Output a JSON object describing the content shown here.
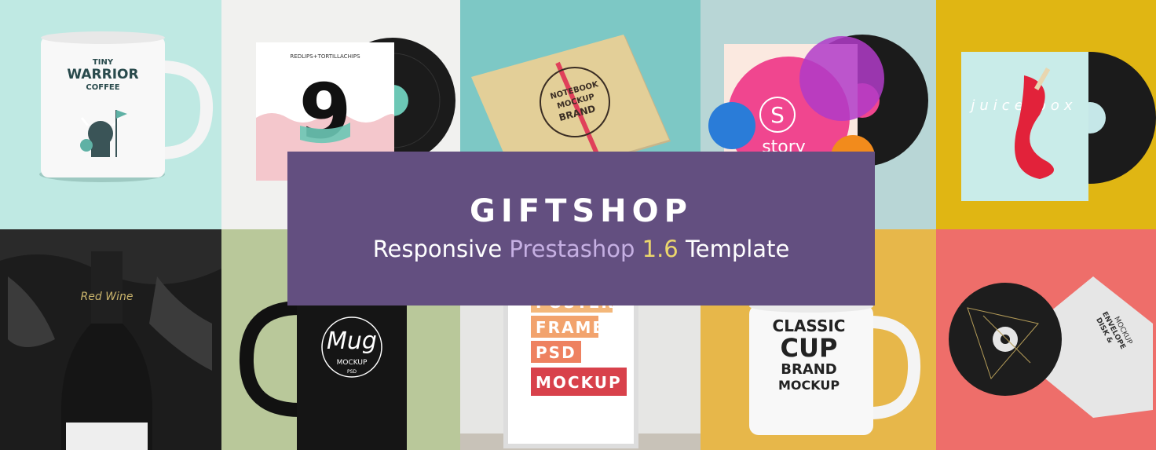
{
  "banner": {
    "title": "GIFTSHOP",
    "subtitle": {
      "part1": "Responsive ",
      "part2": "Prestashop",
      "part3": " ",
      "part4": "1.6",
      "part5": " Template"
    },
    "overlay_color": "#634f80",
    "highlight_color_1": "#c6b0e3",
    "highlight_color_2": "#ecd76c"
  },
  "tiles": {
    "mug1": {
      "line1": "TINY",
      "line2": "WARRIOR",
      "line3": "COFFEE",
      "icon": "viking-icon"
    },
    "vinyl1": {
      "top_text": "REDLIPS+TORTILLACHIPS",
      "number": "9",
      "icon": "vinyl-record-icon"
    },
    "notebook": {
      "badge_line1": "NOTEBOOK",
      "badge_line2": "MOCKUP",
      "badge_line3": "BRAND",
      "icon": "notebook-icon"
    },
    "vinyl2": {
      "letter": "S",
      "word": "story",
      "icon": "vinyl-record-icon"
    },
    "vinyl3": {
      "script": "juice box",
      "icon": "popsicle-icon"
    },
    "wine": {
      "label": "Red Wine",
      "icon": "wine-bottle-icon"
    },
    "mug2": {
      "script": "Mug",
      "line2": "MOCKUP",
      "line3": "PSD",
      "icon": "mug-icon"
    },
    "poster": {
      "line0": "POSTER",
      "line1": "FRAME",
      "line2": "PSD",
      "line3": "MOCKUP",
      "icon": "poster-frame-icon"
    },
    "mug3": {
      "line1": "CLASSIC",
      "line2": "CUP",
      "line3": "BRAND",
      "line4": "MOCKUP",
      "icon": "mug-icon"
    },
    "disk": {
      "line1": "DISK &",
      "line2": "ENVELOPE",
      "line3": "MOCKUP",
      "icon": "cd-disk-icon"
    }
  }
}
